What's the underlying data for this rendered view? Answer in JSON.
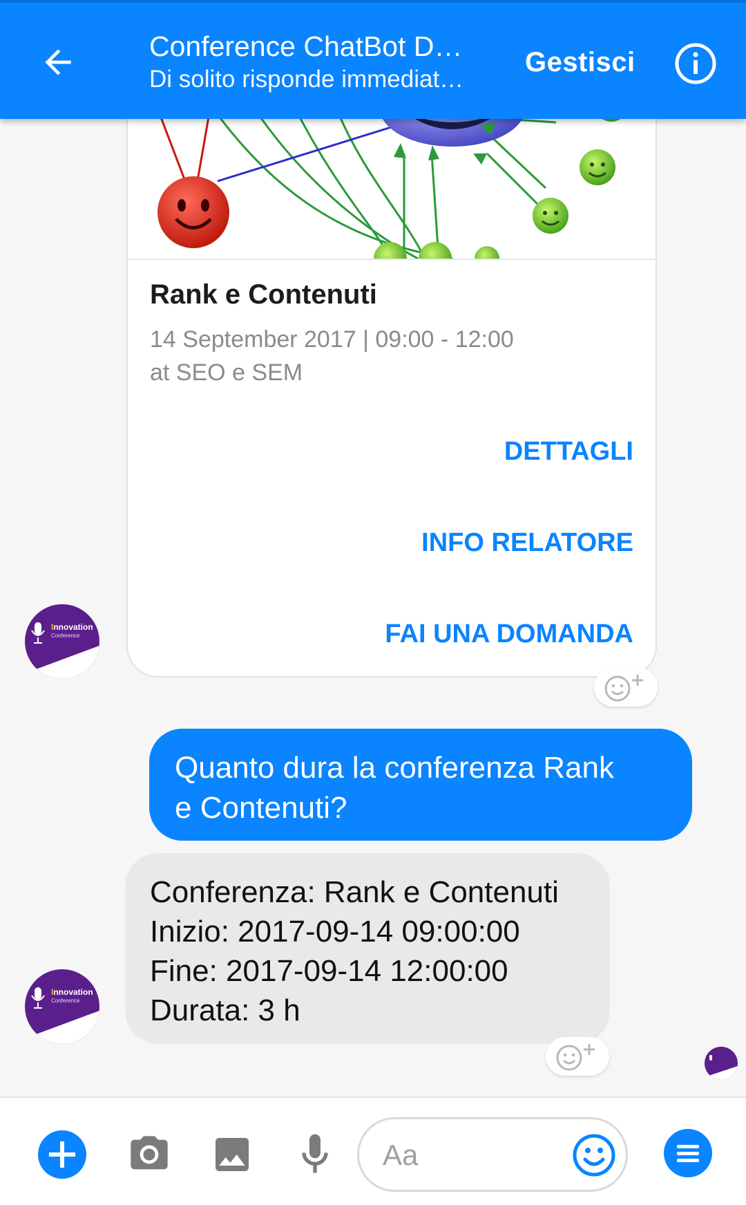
{
  "header": {
    "title": "Conference ChatBot De…",
    "subtitle": "Di solito risponde immediat…",
    "manage_label": "Gestisci"
  },
  "card": {
    "title": "Rank e Contenuti",
    "date_line": "14 September 2017 | 09:00 - 12:00",
    "location_line": "at SEO e SEM",
    "buttons": [
      "DETTAGLI",
      "INFO RELATORE",
      "FAI UNA DOMANDA"
    ]
  },
  "avatar": {
    "brand_word": "nnovation",
    "brand_initial": "I",
    "brand_sub": "Conference"
  },
  "messages": {
    "outgoing": [
      "Quanto dura la conferenza Rank",
      "e Contenuti?"
    ],
    "incoming": [
      "Conferenza: Rank e Contenuti",
      "Inizio: 2017-09-14 09:00:00",
      "Fine: 2017-09-14 12:00:00",
      "Durata: 3 h"
    ]
  },
  "composer": {
    "placeholder": "Aa"
  },
  "colors": {
    "accent": "#0a84ff",
    "incoming_bubble": "#e9e9e9",
    "avatar_purple": "#5b1f8c"
  },
  "icons": {
    "back": "arrow-left-icon",
    "info": "info-circle-icon",
    "reaction": "smiley-plus-icon",
    "plus": "plus-circle-icon",
    "camera": "camera-icon",
    "gallery": "image-icon",
    "mic": "microphone-icon",
    "emoji": "emoji-icon",
    "menu": "menu-icon"
  }
}
